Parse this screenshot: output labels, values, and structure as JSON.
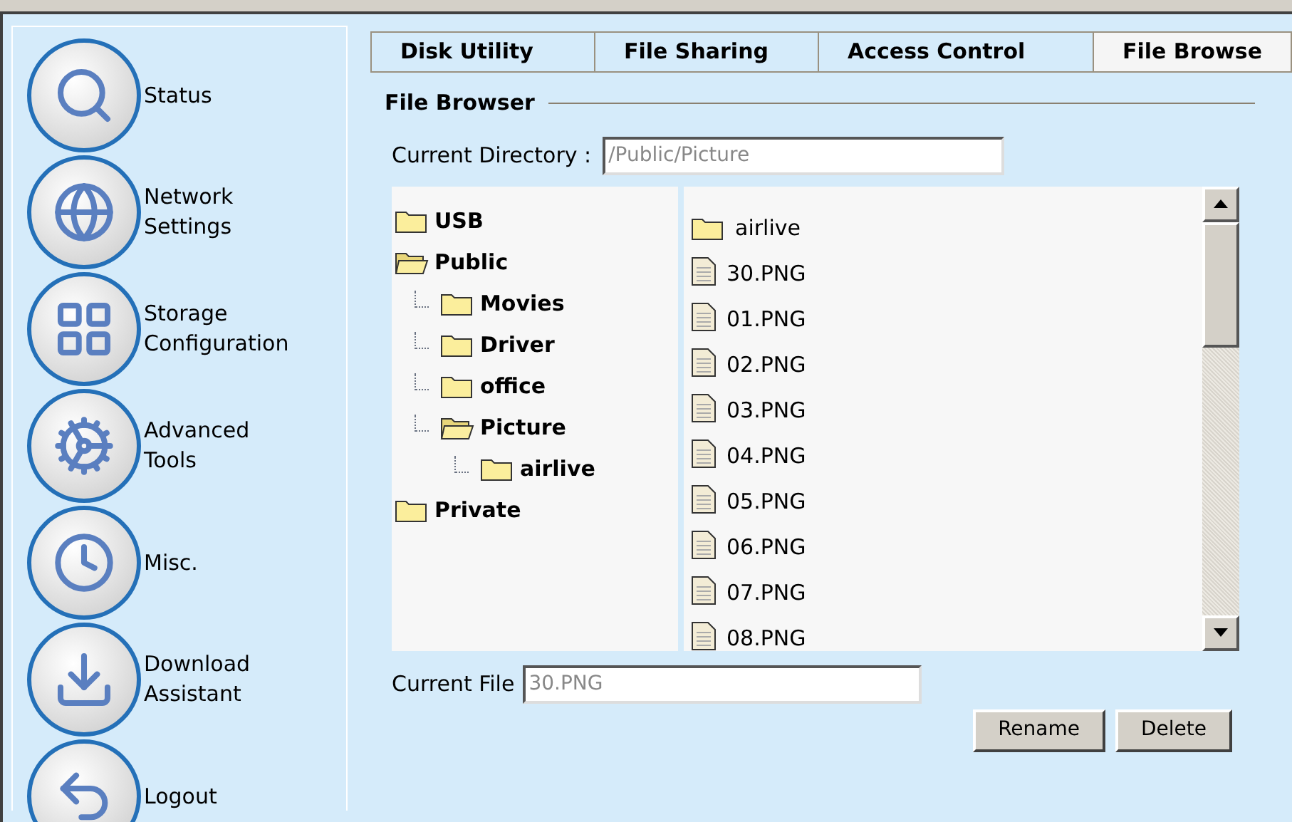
{
  "sidebar": {
    "items": [
      {
        "label": "Status",
        "kind": "status"
      },
      {
        "label": "Network\nSettings",
        "kind": "network"
      },
      {
        "label": "Storage\nConfiguration",
        "kind": "storage"
      },
      {
        "label": "Advanced\nTools",
        "kind": "tools"
      },
      {
        "label": "Misc.",
        "kind": "misc"
      },
      {
        "label": "Download\nAssistant",
        "kind": "download"
      },
      {
        "label": "Logout",
        "kind": "logout"
      }
    ]
  },
  "tabs": [
    {
      "label": "Disk Utility",
      "selected": false
    },
    {
      "label": "File Sharing",
      "selected": false
    },
    {
      "label": "Access Control",
      "selected": false
    },
    {
      "label": "File Browse",
      "selected": true
    }
  ],
  "section_title": "File Browser",
  "current_directory": {
    "label": "Current Directory :",
    "value": "/Public/Picture"
  },
  "tree": [
    {
      "label": "USB",
      "expanded": false
    },
    {
      "label": "Public",
      "expanded": true,
      "children": [
        {
          "label": "Movies",
          "expanded": false
        },
        {
          "label": "Driver",
          "expanded": false
        },
        {
          "label": "office",
          "expanded": false
        },
        {
          "label": "Picture",
          "expanded": true,
          "children": [
            {
              "label": "airlive",
              "expanded": false
            }
          ]
        }
      ]
    },
    {
      "label": "Private",
      "expanded": false
    }
  ],
  "files": [
    {
      "name": "airlive",
      "kind": "folder"
    },
    {
      "name": "30.PNG",
      "kind": "file"
    },
    {
      "name": "01.PNG",
      "kind": "file"
    },
    {
      "name": "02.PNG",
      "kind": "file"
    },
    {
      "name": "03.PNG",
      "kind": "file"
    },
    {
      "name": "04.PNG",
      "kind": "file"
    },
    {
      "name": "05.PNG",
      "kind": "file"
    },
    {
      "name": "06.PNG",
      "kind": "file"
    },
    {
      "name": "07.PNG",
      "kind": "file"
    },
    {
      "name": "08.PNG",
      "kind": "file"
    }
  ],
  "current_file": {
    "label": "Current File",
    "value": "30.PNG"
  },
  "buttons": [
    "Rename",
    "Delete"
  ]
}
